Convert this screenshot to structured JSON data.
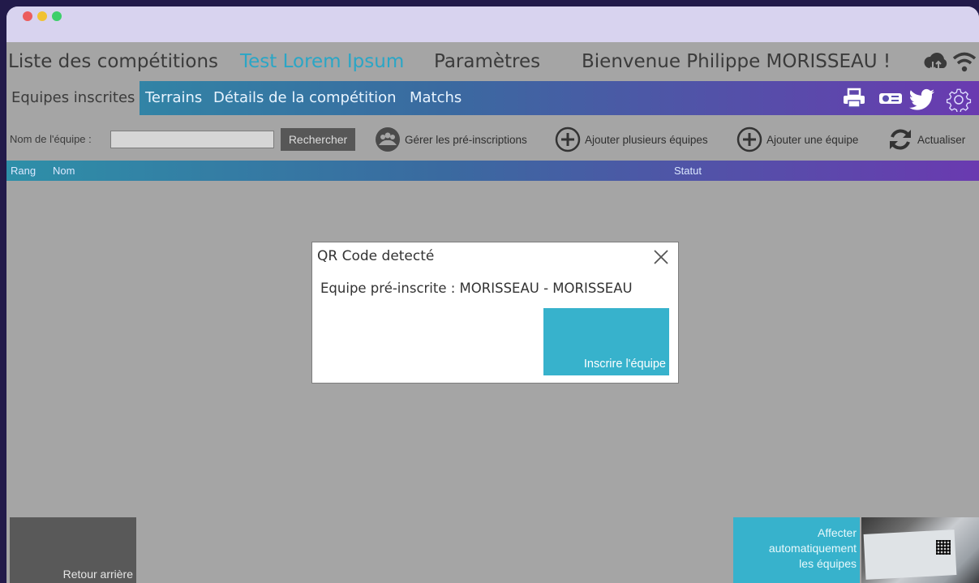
{
  "header": {
    "competitions": "Liste des compétitions",
    "current": "Test Lorem Ipsum",
    "settings": "Paramètres",
    "welcome": "Bienvenue Philippe MORISSEAU !"
  },
  "tabs": [
    "Equipes inscrites",
    "Terrains",
    "Détails de la compétition",
    "Matchs"
  ],
  "toolbar": {
    "team_label": "Nom de l'équipe :",
    "team_value": "",
    "search": "Rechercher",
    "manage": "Gérer les pré-inscriptions",
    "add_many": "Ajouter plusieurs équipes",
    "add_one": "Ajouter une équipe",
    "refresh": "Actualiser"
  },
  "columns": {
    "rank": "Rang",
    "name": "Nom",
    "status": "Statut"
  },
  "modal": {
    "title": "QR Code detecté",
    "message": "Equipe pré-inscrite : MORISSEAU - MORISSEAU",
    "button": "Inscrire l'équipe"
  },
  "footer": {
    "back": "Retour arrière",
    "affect_1": "Affecter",
    "affect_2": "automatiquement",
    "affect_3": "les équipes"
  },
  "colors": {
    "accent": "#2aa6c6",
    "button_cyan": "#37b2cc",
    "gradient_start": "#2e8fa8",
    "gradient_end": "#6a3ab0"
  }
}
